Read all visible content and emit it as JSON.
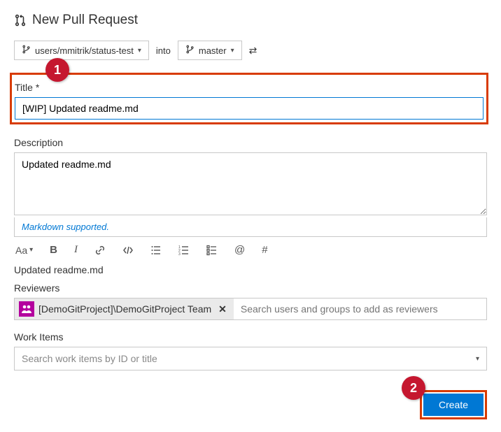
{
  "header": {
    "title": "New Pull Request"
  },
  "branches": {
    "source": "users/mmitrik/status-test",
    "into_label": "into",
    "target": "master"
  },
  "title_field": {
    "label": "Title",
    "value": "[WIP] Updated readme.md"
  },
  "description": {
    "label": "Description",
    "value": "Updated readme.md",
    "markdown_note": "Markdown supported."
  },
  "toolbar": {
    "font_size": "Aa",
    "bold": "B",
    "italic": "I",
    "mention": "@",
    "hash": "#"
  },
  "preview": {
    "text": "Updated readme.md"
  },
  "reviewers": {
    "label": "Reviewers",
    "chip": "[DemoGitProject]\\DemoGitProject Team",
    "placeholder": "Search users and groups to add as reviewers"
  },
  "work_items": {
    "label": "Work Items",
    "placeholder": "Search work items by ID or title"
  },
  "footer": {
    "create": "Create"
  },
  "callouts": {
    "one": "1",
    "two": "2"
  }
}
